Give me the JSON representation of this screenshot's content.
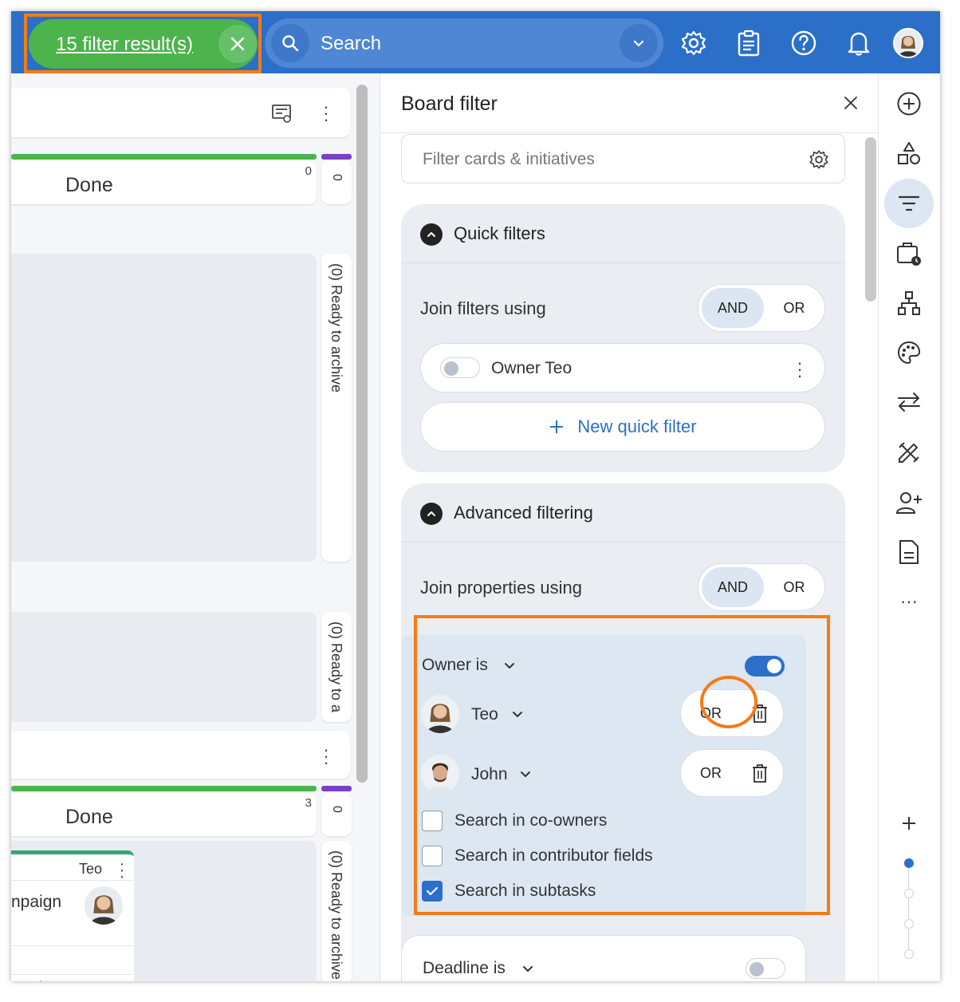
{
  "topbar": {
    "filter_results": "15 filter result(s)",
    "search_placeholder": "Search"
  },
  "board": {
    "column1": {
      "title": "Done",
      "count": "0",
      "archive_count": "0",
      "archive_label": "(0) Ready to archive"
    },
    "column2_archive_label": "(0) Ready to a",
    "column3": {
      "title": "Done",
      "count": "3",
      "archive_count": "0",
      "archive_label": "(0) Ready to archive"
    },
    "card": {
      "owner": "Teo",
      "title_fragment": "npaign",
      "footer_fragment": "mpaigns"
    }
  },
  "panel": {
    "title": "Board filter",
    "search_placeholder": "Filter cards & initiatives",
    "quick_filters": {
      "title": "Quick filters",
      "join_label": "Join filters using",
      "and_label": "AND",
      "or_label": "OR",
      "items": [
        {
          "label": "Owner Teo"
        }
      ],
      "new_label": "New quick filter"
    },
    "advanced": {
      "title": "Advanced filtering",
      "join_label": "Join properties using",
      "and_label": "AND",
      "or_label": "OR",
      "owner_rule": {
        "label": "Owner is",
        "people": [
          {
            "name": "Teo",
            "op": "OR"
          },
          {
            "name": "John",
            "op": "OR"
          }
        ],
        "options": [
          {
            "label": "Search in co-owners",
            "checked": false
          },
          {
            "label": "Search in contributor fields",
            "checked": false
          },
          {
            "label": "Search in subtasks",
            "checked": true
          }
        ]
      },
      "deadline_rule": {
        "label": "Deadline is"
      }
    }
  },
  "colors": {
    "primary": "#2c6fc9",
    "green": "#4cb34d",
    "highlight": "#f47b16",
    "purple": "#7b3fc4"
  }
}
